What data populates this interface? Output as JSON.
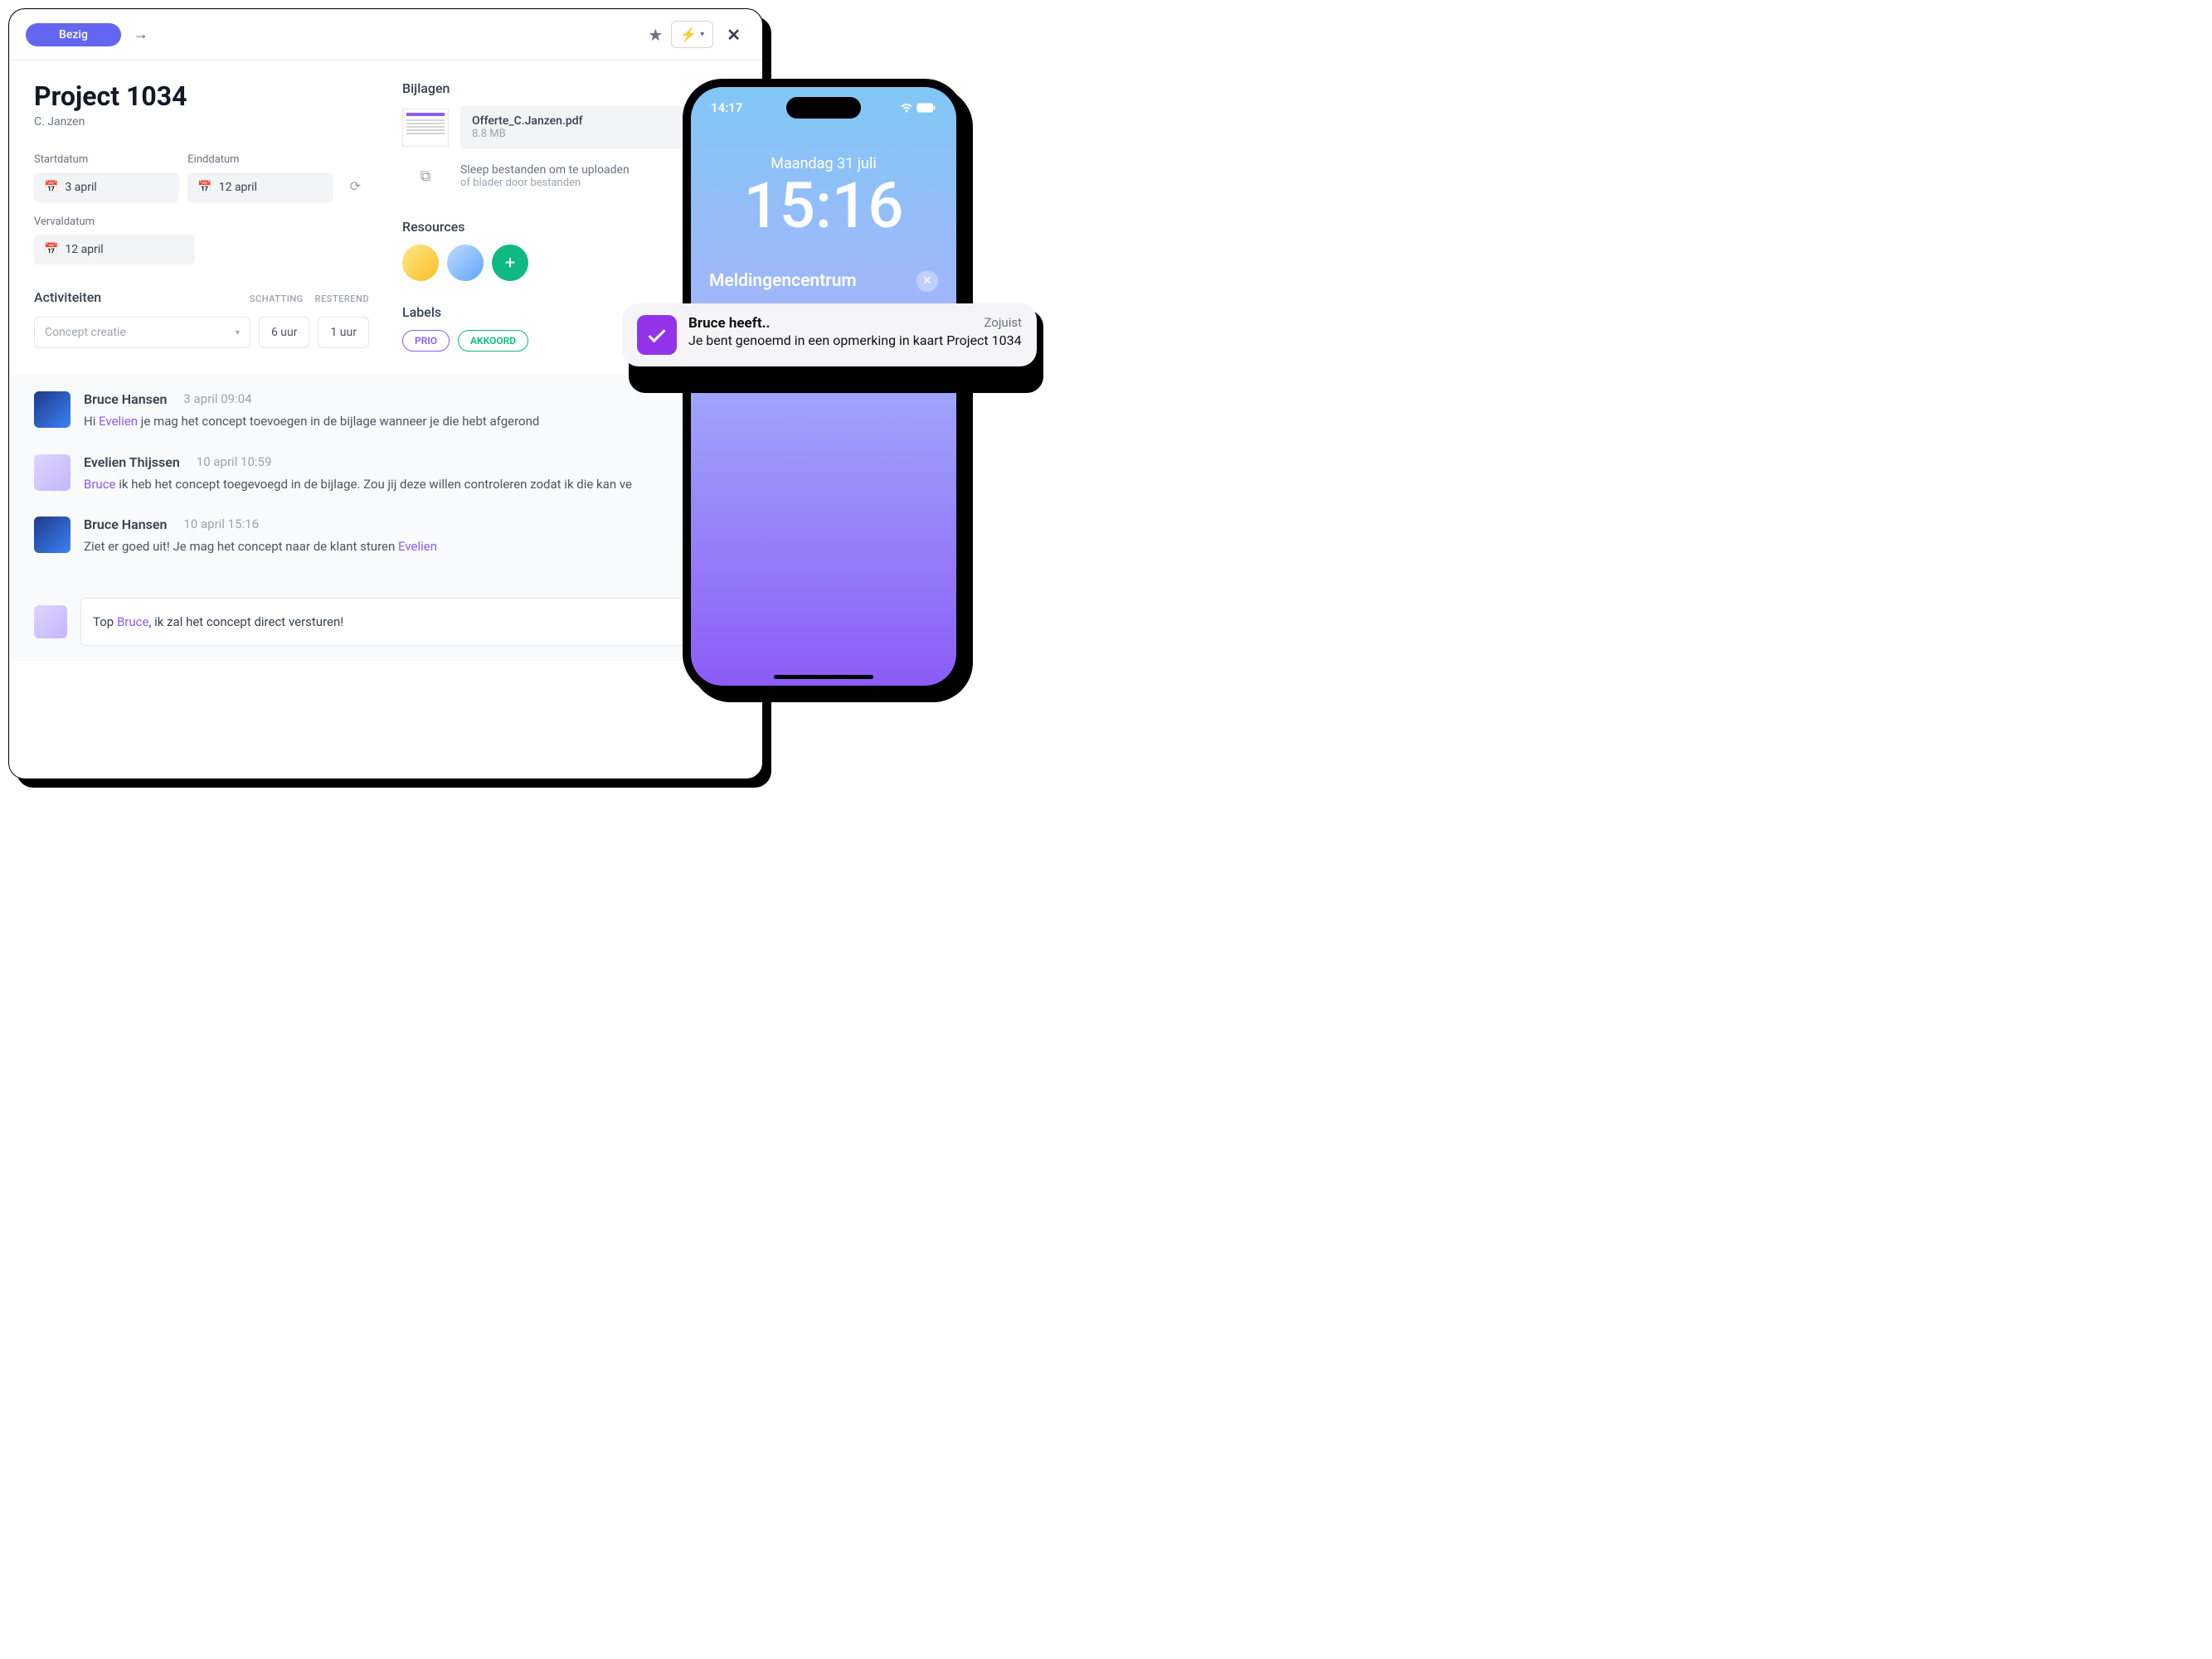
{
  "header": {
    "status": "Bezig"
  },
  "project": {
    "title": "Project 1034",
    "owner": "C. Janzen"
  },
  "dates": {
    "start_label": "Startdatum",
    "start_value": "3 april",
    "end_label": "Einddatum",
    "end_value": "12 april",
    "due_label": "Vervaldatum",
    "due_value": "12 april"
  },
  "activities": {
    "title": "Activiteiten",
    "col_estimate": "SCHATTING",
    "col_remaining": "RESTEREND",
    "select_placeholder": "Concept creatie",
    "estimate": "6 uur",
    "remaining": "1 uur"
  },
  "attachments": {
    "title": "Bijlagen",
    "file_name": "Offerte_C.Janzen.pdf",
    "file_size": "8.8 MB",
    "upload_line1": "Sleep bestanden om te uploaden",
    "upload_line2": "of blader door bestanden"
  },
  "resources": {
    "title": "Resources"
  },
  "labels": {
    "title": "Labels",
    "prio": "PRIO",
    "akkoord": "AKKOORD"
  },
  "comments": [
    {
      "author": "Bruce Hansen",
      "time": "3 april 09:04",
      "prefix": "Hi ",
      "mention": "Evelien",
      "suffix": " je mag het concept toevoegen in de bijlage wanneer je die hebt afgerond",
      "avatar": "man"
    },
    {
      "author": "Evelien Thijssen",
      "time": "10 april 10:59",
      "prefix": "",
      "mention": "Bruce",
      "suffix": " ik heb het concept toegevoegd in de bijlage. Zou jij deze willen controleren zodat ik die kan ve",
      "avatar": "woman"
    },
    {
      "author": "Bruce Hansen",
      "time": "10 april 15:16",
      "prefix": "Ziet er goed uit! Je mag het concept naar de klant sturen ",
      "mention": "Evelien",
      "suffix": "",
      "avatar": "man"
    }
  ],
  "composer": {
    "prefix": "Top ",
    "mention": "Bruce",
    "suffix": ", ik zal het concept direct versturen!"
  },
  "phone": {
    "status_time": "14:17",
    "lock_date": "Maandag 31 juli",
    "lock_time": "15:16",
    "notif_center": "Meldingencentrum"
  },
  "notification": {
    "title": "Bruce heeft..",
    "time": "Zojuist",
    "message": "Je bent genoemd in een opmerking in kaart Project 1034"
  }
}
